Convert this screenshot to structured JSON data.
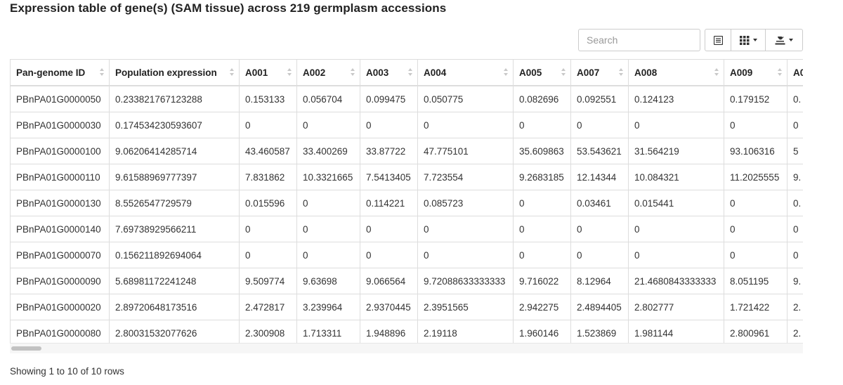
{
  "title": "Expression table of gene(s) (SAM tissue) across 219 germplasm accessions",
  "toolbar": {
    "search_placeholder": "Search",
    "list_icon": "list-icon",
    "columns_icon": "columns-grid-icon",
    "export_icon": "download-export-icon"
  },
  "table": {
    "columns": [
      "Pan-genome ID",
      "Population expression",
      "A001",
      "A002",
      "A003",
      "A004",
      "A005",
      "A007",
      "A008",
      "A009",
      "A0"
    ],
    "rows": [
      [
        "PBnPA01G0000050",
        "0.233821767123288",
        "0.153133",
        "0.056704",
        "0.099475",
        "0.050775",
        "0.082696",
        "0.092551",
        "0.124123",
        "0.179152",
        "0."
      ],
      [
        "PBnPA01G0000030",
        "0.174534230593607",
        "0",
        "0",
        "0",
        "0",
        "0",
        "0",
        "0",
        "0",
        "0"
      ],
      [
        "PBnPA01G0000100",
        "9.06206414285714",
        "43.460587",
        "33.400269",
        "33.87722",
        "47.775101",
        "35.609863",
        "53.543621",
        "31.564219",
        "93.106316",
        "5"
      ],
      [
        "PBnPA01G0000110",
        "9.61588969777397",
        "7.831862",
        "10.3321665",
        "7.5413405",
        "7.723554",
        "9.2683185",
        "12.14344",
        "10.084321",
        "11.2025555",
        "9."
      ],
      [
        "PBnPA01G0000130",
        "8.5526547729579",
        "0.015596",
        "0",
        "0.114221",
        "0.085723",
        "0",
        "0.03461",
        "0.015441",
        "0",
        "0."
      ],
      [
        "PBnPA01G0000140",
        "7.69738929566211",
        "0",
        "0",
        "0",
        "0",
        "0",
        "0",
        "0",
        "0",
        "0"
      ],
      [
        "PBnPA01G0000070",
        "0.156211892694064",
        "0",
        "0",
        "0",
        "0",
        "0",
        "0",
        "0",
        "0",
        "0"
      ],
      [
        "PBnPA01G0000090",
        "5.68981172241248",
        "9.509774",
        "9.63698",
        "9.066564",
        "9.72088633333333",
        "9.716022",
        "8.12964",
        "21.4680843333333",
        "8.051195",
        "9."
      ],
      [
        "PBnPA01G0000020",
        "2.89720648173516",
        "2.472817",
        "3.239964",
        "2.9370445",
        "2.3951565",
        "2.942275",
        "2.4894405",
        "2.802777",
        "1.721422",
        "2."
      ],
      [
        "PBnPA01G0000080",
        "2.80031532077626",
        "2.300908",
        "1.713311",
        "1.948896",
        "2.19118",
        "1.960146",
        "1.523869",
        "1.981144",
        "2.800961",
        "2."
      ]
    ]
  },
  "footer": {
    "pagination_info": "Showing 1 to 10 of 10 rows"
  }
}
